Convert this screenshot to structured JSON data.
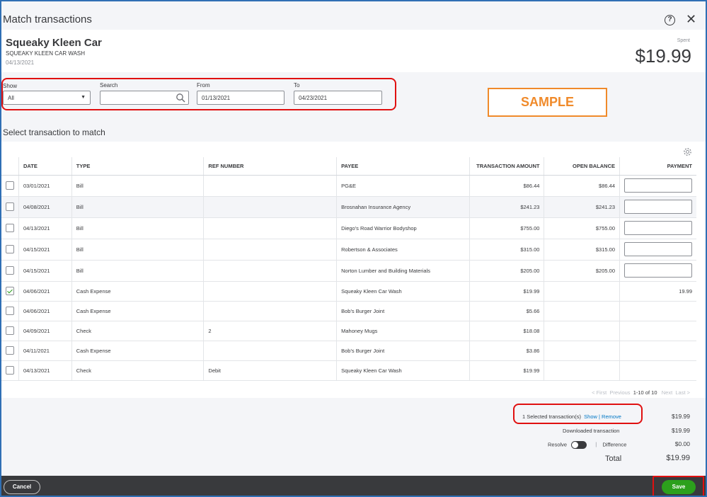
{
  "dialog": {
    "title": "Match transactions"
  },
  "header": {
    "payee": "Squeaky Kleen Car",
    "description": "SQUEAKY KLEEN CAR WASH",
    "date": "04/13/2021",
    "spent_label": "Spent",
    "amount": "$19.99"
  },
  "filters": {
    "show_label": "Show",
    "show_value": "All",
    "search_label": "Search",
    "search_value": "",
    "from_label": "From",
    "from_value": "01/13/2021",
    "to_label": "To",
    "to_value": "04/23/2021"
  },
  "watermark": "SAMPLE",
  "section_title": "Select transaction to match",
  "table": {
    "columns": [
      "DATE",
      "TYPE",
      "REF NUMBER",
      "PAYEE",
      "TRANSACTION AMOUNT",
      "OPEN BALANCE",
      "PAYMENT"
    ],
    "rows": [
      {
        "checked": false,
        "date": "03/01/2021",
        "type": "Bill",
        "ref": "",
        "payee": "PG&E",
        "amount": "$86.44",
        "open_balance": "$86.44",
        "payment": "",
        "payment_input": true
      },
      {
        "checked": false,
        "date": "04/08/2021",
        "type": "Bill",
        "ref": "",
        "payee": "Brosnahan Insurance Agency",
        "amount": "$241.23",
        "open_balance": "$241.23",
        "payment": "",
        "payment_input": true
      },
      {
        "checked": false,
        "date": "04/13/2021",
        "type": "Bill",
        "ref": "",
        "payee": "Diego's Road Warrior Bodyshop",
        "amount": "$755.00",
        "open_balance": "$755.00",
        "payment": "",
        "payment_input": true
      },
      {
        "checked": false,
        "date": "04/15/2021",
        "type": "Bill",
        "ref": "",
        "payee": "Robertson & Associates",
        "amount": "$315.00",
        "open_balance": "$315.00",
        "payment": "",
        "payment_input": true
      },
      {
        "checked": false,
        "date": "04/15/2021",
        "type": "Bill",
        "ref": "",
        "payee": "Norton Lumber and Building Materials",
        "amount": "$205.00",
        "open_balance": "$205.00",
        "payment": "",
        "payment_input": true
      },
      {
        "checked": true,
        "date": "04/06/2021",
        "type": "Cash Expense",
        "ref": "",
        "payee": "Squeaky Kleen Car Wash",
        "amount": "$19.99",
        "open_balance": "",
        "payment": "19.99",
        "payment_input": false
      },
      {
        "checked": false,
        "date": "04/06/2021",
        "type": "Cash Expense",
        "ref": "",
        "payee": "Bob's Burger Joint",
        "amount": "$5.66",
        "open_balance": "",
        "payment": "",
        "payment_input": false
      },
      {
        "checked": false,
        "date": "04/09/2021",
        "type": "Check",
        "ref": "2",
        "payee": "Mahoney Mugs",
        "amount": "$18.08",
        "open_balance": "",
        "payment": "",
        "payment_input": false
      },
      {
        "checked": false,
        "date": "04/11/2021",
        "type": "Cash Expense",
        "ref": "",
        "payee": "Bob's Burger Joint",
        "amount": "$3.86",
        "open_balance": "",
        "payment": "",
        "payment_input": false
      },
      {
        "checked": false,
        "date": "04/13/2021",
        "type": "Check",
        "ref": "Debit",
        "payee": "Squeaky Kleen Car Wash",
        "amount": "$19.99",
        "open_balance": "",
        "payment": "",
        "payment_input": false
      }
    ]
  },
  "pager": {
    "first": "< First",
    "previous": "Previous",
    "range": "1-10 of 10",
    "next": "Next",
    "last": "Last >"
  },
  "summary": {
    "selected_text": "1 Selected transaction(s)",
    "show_link": "Show",
    "separator": "|",
    "remove_link": "Remove",
    "selected_amount": "$19.99",
    "downloaded_label": "Downloaded transaction",
    "downloaded_amount": "$19.99",
    "resolve_label": "Resolve",
    "difference_label": "Difference",
    "difference_amount": "$0.00",
    "total_label": "Total",
    "total_amount": "$19.99"
  },
  "footer": {
    "cancel_label": "Cancel",
    "save_label": "Save"
  },
  "colors": {
    "accent_green": "#2ca01c",
    "highlight_red": "#e01010",
    "watermark_orange": "#f08a2a",
    "link_blue": "#0077c5"
  }
}
